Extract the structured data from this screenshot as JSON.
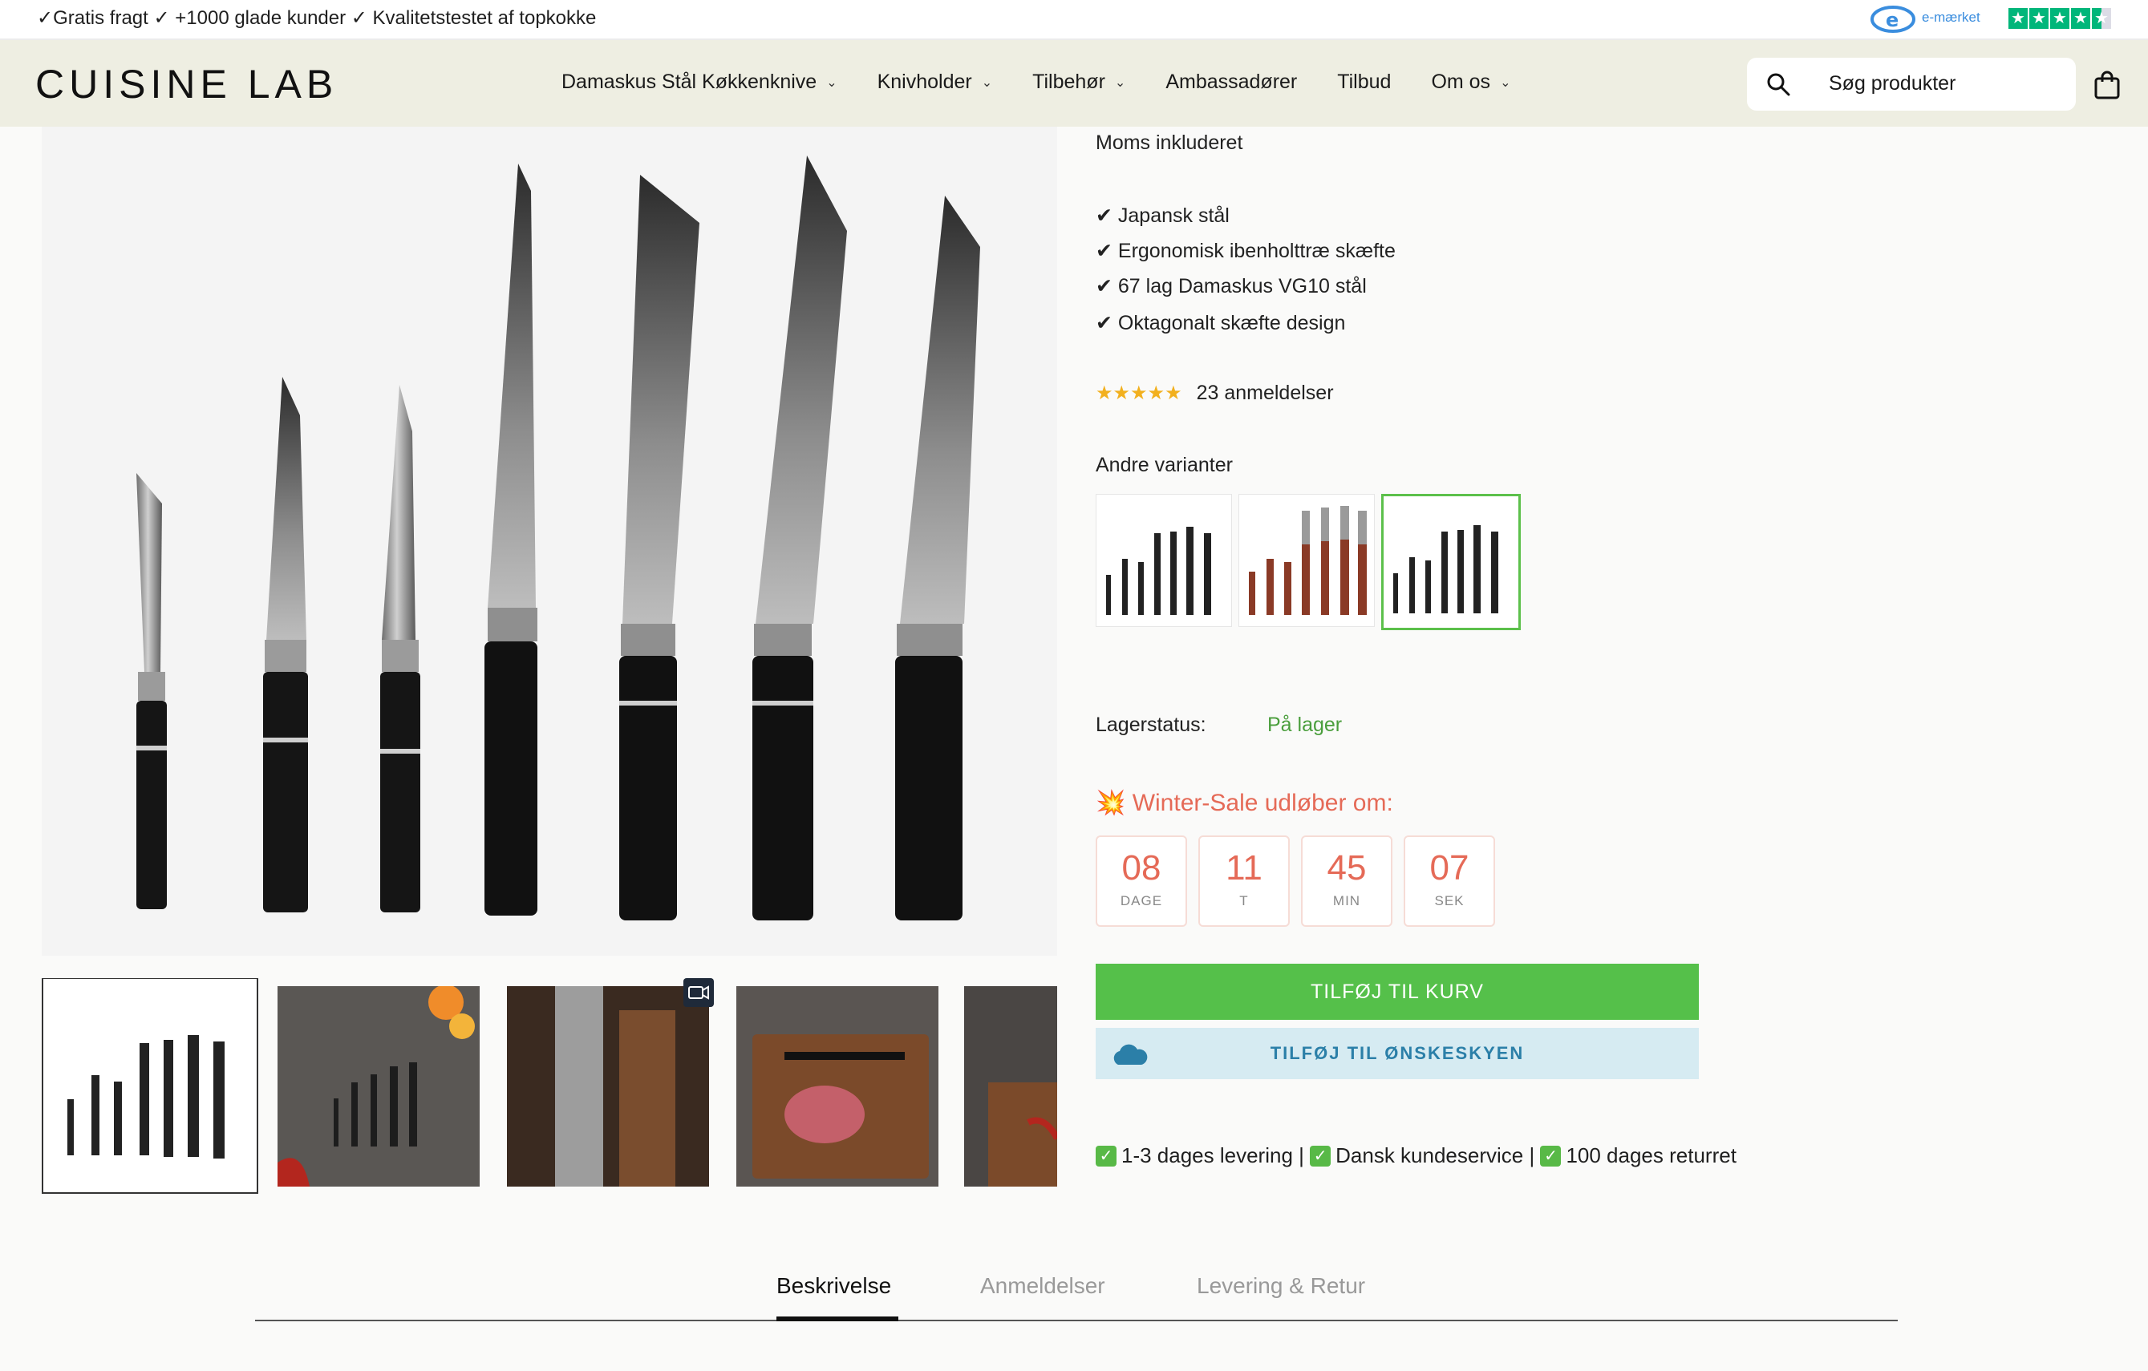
{
  "announcement": {
    "text": "✓Gratis fragt ✓ +1000 glade kunder ✓ Kvalitetstestet af topkokke",
    "emaerket_label": "e-mærket"
  },
  "header": {
    "logo": "CUISINE LAB",
    "nav": [
      {
        "label": "Damaskus Stål Køkkenknive",
        "has_dropdown": true
      },
      {
        "label": "Knivholder",
        "has_dropdown": true
      },
      {
        "label": "Tilbehør",
        "has_dropdown": true
      },
      {
        "label": "Ambassadører",
        "has_dropdown": false
      },
      {
        "label": "Tilbud",
        "has_dropdown": false
      },
      {
        "label": "Om os",
        "has_dropdown": true
      }
    ],
    "search_placeholder": "Søg produkter"
  },
  "product": {
    "tax_note": "Moms inkluderet",
    "features": [
      "✔ Japansk stål",
      "✔ Ergonomisk ibenholttræ skæfte",
      "✔ 67 lag Damaskus VG10 stål",
      "✔ Oktagonalt skæfte design"
    ],
    "rating_stars": 5,
    "reviews_text": "23 anmeldelser",
    "variants_label": "Andre varianter",
    "variants_selected_index": 2,
    "stock_label": "Lagerstatus:",
    "stock_value": "På lager",
    "sale_text": "Winter-Sale udløber om:",
    "countdown": [
      {
        "value": "08",
        "unit": "DAGE"
      },
      {
        "value": "11",
        "unit": "T"
      },
      {
        "value": "45",
        "unit": "MIN"
      },
      {
        "value": "07",
        "unit": "SEK"
      }
    ],
    "add_to_cart": "TILFØJ TIL KURV",
    "add_to_wishlist": "TILFØJ TIL ØNSKESKYEN",
    "benefits": [
      "1-3 dages levering",
      "Dansk kundeservice",
      "100 dages returret"
    ]
  },
  "tabs": [
    {
      "label": "Beskrivelse",
      "active": true
    },
    {
      "label": "Anmeldelser",
      "active": false
    },
    {
      "label": "Levering & Retur",
      "active": false
    }
  ],
  "colors": {
    "accent_green": "#55c04a",
    "sale_red": "#e56a57",
    "header_bg": "#eeeee2",
    "wish_bg": "#d6ebf2"
  }
}
